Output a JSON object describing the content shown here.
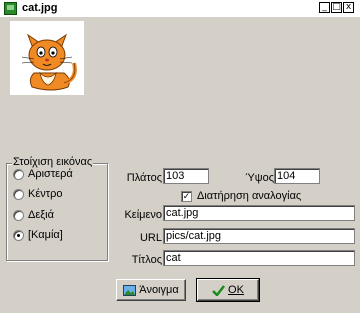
{
  "window": {
    "title": "cat.jpg",
    "minimize_label": "_",
    "maximize_label": "□",
    "close_label": "x"
  },
  "preview": {
    "image_alt": "cat"
  },
  "alignment": {
    "legend": "Στοίχιση εικόνας",
    "options": [
      {
        "label": "Αριστερά",
        "checked": false
      },
      {
        "label": "Κέντρο",
        "checked": false
      },
      {
        "label": "Δεξιά",
        "checked": false
      },
      {
        "label": "[Καμία]",
        "checked": true
      }
    ]
  },
  "fields": {
    "width_label": "Πλάτος",
    "width_value": "103",
    "height_label": "Ύψος",
    "height_value": "104",
    "keep_ratio_label": "Διατήρηση αναλογίας",
    "keep_ratio_checked": true,
    "text_label": "Κείμενο",
    "text_value": "cat.jpg",
    "url_label": "URL",
    "url_value": "pics/cat.jpg",
    "title_label": "Τίτλος",
    "title_value": "cat"
  },
  "buttons": {
    "open_label": "Άνοιγμα",
    "ok_label": "OK"
  },
  "colors": {
    "ok_check": "#1a8a1a",
    "title_icon": "#2a8a2a",
    "cat_orange": "#f08a24"
  }
}
